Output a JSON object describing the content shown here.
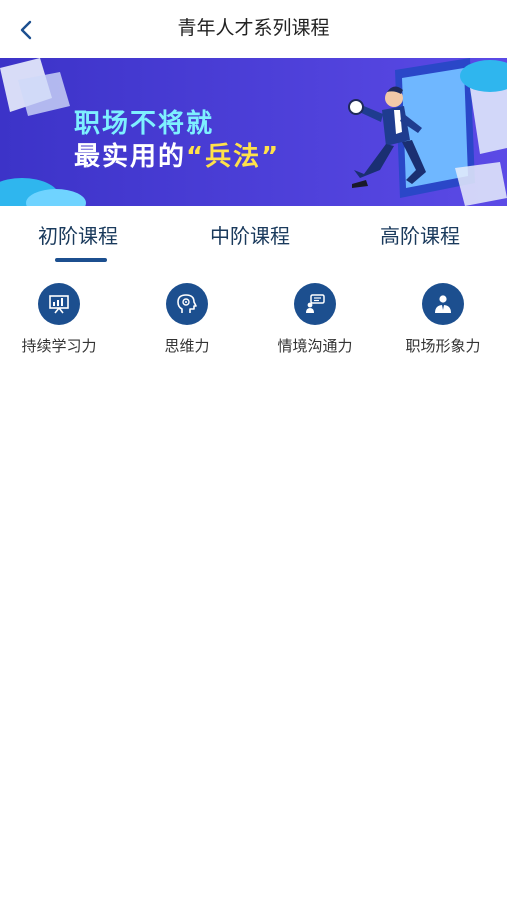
{
  "header": {
    "title": "青年人才系列课程",
    "back_icon": "chevron-left-icon"
  },
  "banner": {
    "line1": "职场不将就",
    "line2_prefix": "最实用的",
    "line2_highlight": "“兵法”",
    "colors": {
      "background": "#4a3ed6",
      "line1": "#7ef0ff",
      "highlight": "#ffe14a"
    }
  },
  "tabs": [
    {
      "label": "初阶课程",
      "active": true
    },
    {
      "label": "中阶课程",
      "active": false
    },
    {
      "label": "高阶课程",
      "active": false
    }
  ],
  "categories": [
    {
      "label": "持续学习力",
      "icon": "presentation-chart-icon"
    },
    {
      "label": "思维力",
      "icon": "brain-head-icon"
    },
    {
      "label": "情境沟通力",
      "icon": "conversation-icon"
    },
    {
      "label": "职场形象力",
      "icon": "business-person-icon"
    }
  ],
  "accent_color": "#1c4f8f"
}
